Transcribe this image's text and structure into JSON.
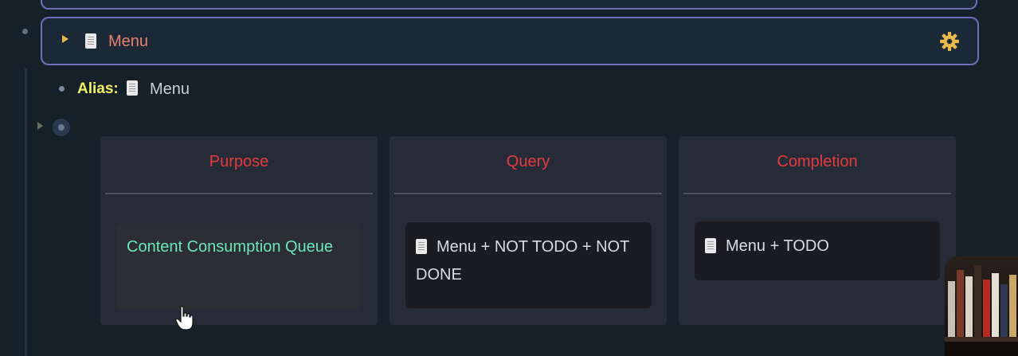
{
  "block": {
    "title": "Menu",
    "icon": "page-icon",
    "settings_icon": "gear-icon"
  },
  "alias": {
    "key": "Alias:",
    "value": "Menu"
  },
  "columns": [
    {
      "header": "Purpose",
      "body": "Content Consumption Queue"
    },
    {
      "header": "Query",
      "body": "Menu + NOT TODO + NOT DONE"
    },
    {
      "header": "Completion",
      "body": "Menu + TODO"
    }
  ],
  "colors": {
    "background": "#152028",
    "block_border": "#6f6fb6",
    "title": "#e8806a",
    "alias_key": "#f2ef66",
    "column_header": "#e6393d",
    "purpose_text": "#6ee6b8",
    "gear": "#e8b84a"
  }
}
